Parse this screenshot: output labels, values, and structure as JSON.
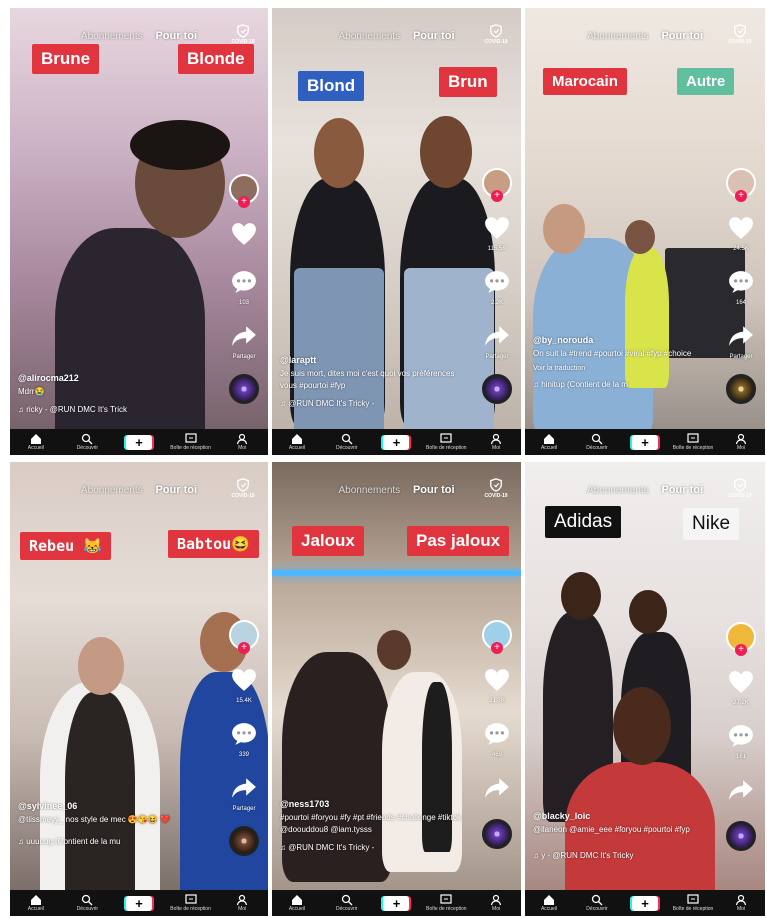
{
  "nav": {
    "following": "Abonnements",
    "foryou": "Pour toi",
    "covid": "COVID-19"
  },
  "bottom": {
    "home": "Accueil",
    "discover": "Découvrir",
    "inbox": "Boîte de réception",
    "me": "Moi",
    "create": "+"
  },
  "panels": [
    {
      "labels": [
        "Brune",
        "Blonde"
      ],
      "counts": {
        "likes": "",
        "comments": "103",
        "share": "Partager"
      },
      "user": "@alirocma212",
      "desc": "Mdrr😭",
      "music": "♫ ricky - @RUN DMC   It's Trick"
    },
    {
      "labels": [
        "Blond",
        "Brun"
      ],
      "counts": {
        "likes": "115.5K",
        "comments": "2.2K",
        "share": "Partager"
      },
      "user": "@laraptt",
      "desc": "Je suis mort, dites moi c'est quoi vos préférences vous #pourtoi #fyp",
      "music": "♫ @RUN DMC   It's Tricky -"
    },
    {
      "labels": [
        "Marocain",
        "Autre"
      ],
      "counts": {
        "likes": "24.5K",
        "comments": "164",
        "share": "Partager"
      },
      "user": "@by_norouda",
      "desc": "On suit la #trend #pourtoi #viral #fyp #choice",
      "translate": "Voir la traduction",
      "music": "♫ hinitup (Contient de la m"
    },
    {
      "labels": [
        "Rebeu 😹",
        "Babtou😆"
      ],
      "counts": {
        "likes": "15.4K",
        "comments": "339",
        "share": "Partager"
      },
      "user": "@sylvinee_06",
      "desc": "@tiissmeyy_ nos style de mec 😍😘😆 ❤️",
      "music": "♫ uuuuug (Contient de la mu"
    },
    {
      "labels": [
        "Jaloux",
        "Pas jaloux"
      ],
      "counts": {
        "likes": "21.7K",
        "comments": "469",
        "share": ""
      },
      "user": "@ness1703",
      "desc": "#pourtoi #foryou #fy #pt #friends #challenge #tiktok @doouddou8 @iam.tysss",
      "music": "♫ @RUN DMC   It's Tricky -"
    },
    {
      "labels": [
        "Adidas",
        "Nike"
      ],
      "counts": {
        "likes": "27.2K",
        "comments": "161",
        "share": ""
      },
      "user": "@blacky_loic",
      "desc": "@llaneon @amie_eee #foryou #pourtoi #fyp",
      "music": "♫ y - @RUN DMC   It's Tricky"
    }
  ],
  "colors": {
    "label_red": "#e0343e",
    "label_blue": "#2f5fbf",
    "label_teal": "#5fbf9f",
    "tiktok_pink": "#fe2c55",
    "tiktok_cyan": "#25f4ee"
  }
}
